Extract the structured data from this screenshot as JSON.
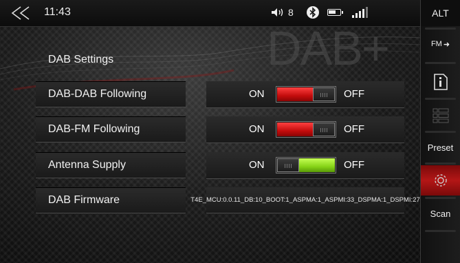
{
  "status_bar": {
    "time": "11:43",
    "volume": "8",
    "icons": [
      "back-chevron-icon",
      "speaker-icon",
      "bluetooth-icon",
      "battery-icon",
      "signal-icon"
    ]
  },
  "sidebar": {
    "alt_label": "ALT",
    "fm_label": "FM",
    "preset_label": "Preset",
    "scan_label": "Scan",
    "active_color": "#b31616"
  },
  "background_logo": "DAB+",
  "settings": {
    "title": "DAB Settings",
    "rows": [
      {
        "label": "DAB-DAB Following",
        "on_label": "ON",
        "off_label": "OFF",
        "state": "on"
      },
      {
        "label": "DAB-FM Following",
        "on_label": "ON",
        "off_label": "OFF",
        "state": "on"
      },
      {
        "label": "Antenna Supply",
        "on_label": "ON",
        "off_label": "OFF",
        "state": "off"
      }
    ],
    "firmware_label": "DAB Firmware",
    "firmware_value": "T4E_MCU:0.0.11_DB:10_BOOT:1_ASPMA:1_ASPMI:33_DSPMA:1_DSPMI:27"
  },
  "colors": {
    "toggle_on": "#d81818",
    "toggle_off": "#86d317"
  }
}
